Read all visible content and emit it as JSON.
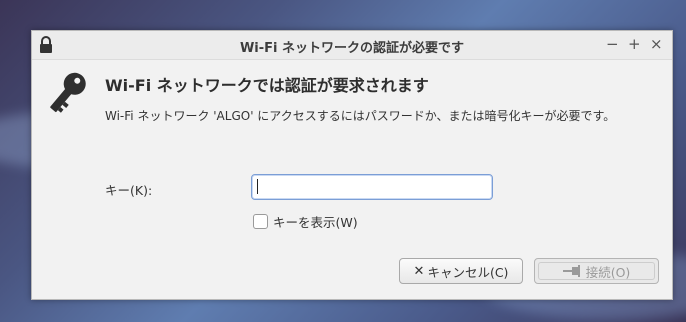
{
  "window": {
    "title": "Wi-Fi ネットワークの認証が必要です",
    "minimize": "−",
    "maximize": "+",
    "close": "×"
  },
  "dialog": {
    "heading": "Wi-Fi ネットワークでは認証が要求されます",
    "message": "Wi-Fi ネットワーク 'ALGO' にアクセスするにはパスワードか、または暗号化キーが必要です。",
    "key_label": "キー(K):",
    "key_value": "",
    "show_key_label": "キーを表示(W)",
    "show_key_checked": false,
    "cancel_label": "キャンセル(C)",
    "connect_label": "接続(O)"
  },
  "colors": {
    "focus_border": "#7b9ed6",
    "dialog_bg": "#f2f2f2"
  }
}
